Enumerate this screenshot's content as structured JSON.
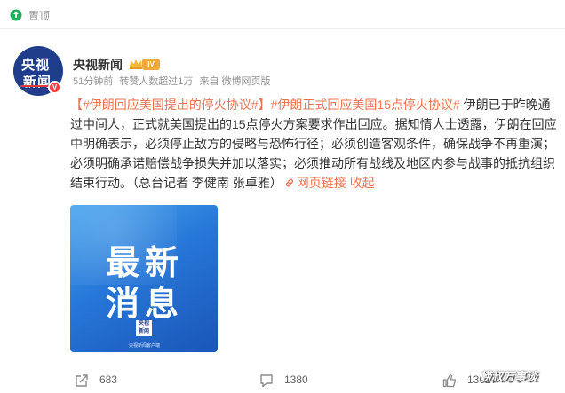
{
  "pin": {
    "label": "置顶"
  },
  "author": {
    "name": "央视新闻",
    "avatar_line1": "央视",
    "avatar_line2": "新闻",
    "level": "IV",
    "verified_mark": "V"
  },
  "meta": {
    "time": "51分钟前",
    "reposts_note": "转赞人数超过1万",
    "source": "来自 微博网页版"
  },
  "post": {
    "topic1": "【#伊朗回应美国提出的停火协议#】",
    "topic2": "#伊朗正式回应美国15点停火协议#",
    "body": " 伊朗已于昨晚通过中间人，正式就美国提出的15点停火方案要求作出回应。据知情人士透露，伊朗在回应中明确表示，必须停止敌方的侵略与恐怖行径；必须创造客观条件，确保战争不再重演；必须明确承诺赔偿战争损失并加以落实；必须推动所有战线及地区内参与战事的抵抗组织结束行动。（总台记者 李健南 张卓雅）",
    "web_link_label": "网页链接",
    "collapse_label": "收起"
  },
  "image": {
    "line1": "最新",
    "line2": "消息",
    "logo_line1": "央视",
    "logo_line2": "新闻",
    "footer": "央视新闻客户端"
  },
  "actions": {
    "repost_count": "683",
    "comment_count": "1380",
    "like_count": "13627"
  },
  "watermark": "崂叔万事谈",
  "colors": {
    "accent": "#eb7350",
    "muted": "#939393",
    "avatar_bg": "#1f3d8a",
    "image_blue": "#2677d8"
  },
  "icons": [
    "pin-icon",
    "crown-icon",
    "link-icon",
    "repost-icon",
    "comment-icon",
    "like-icon"
  ]
}
